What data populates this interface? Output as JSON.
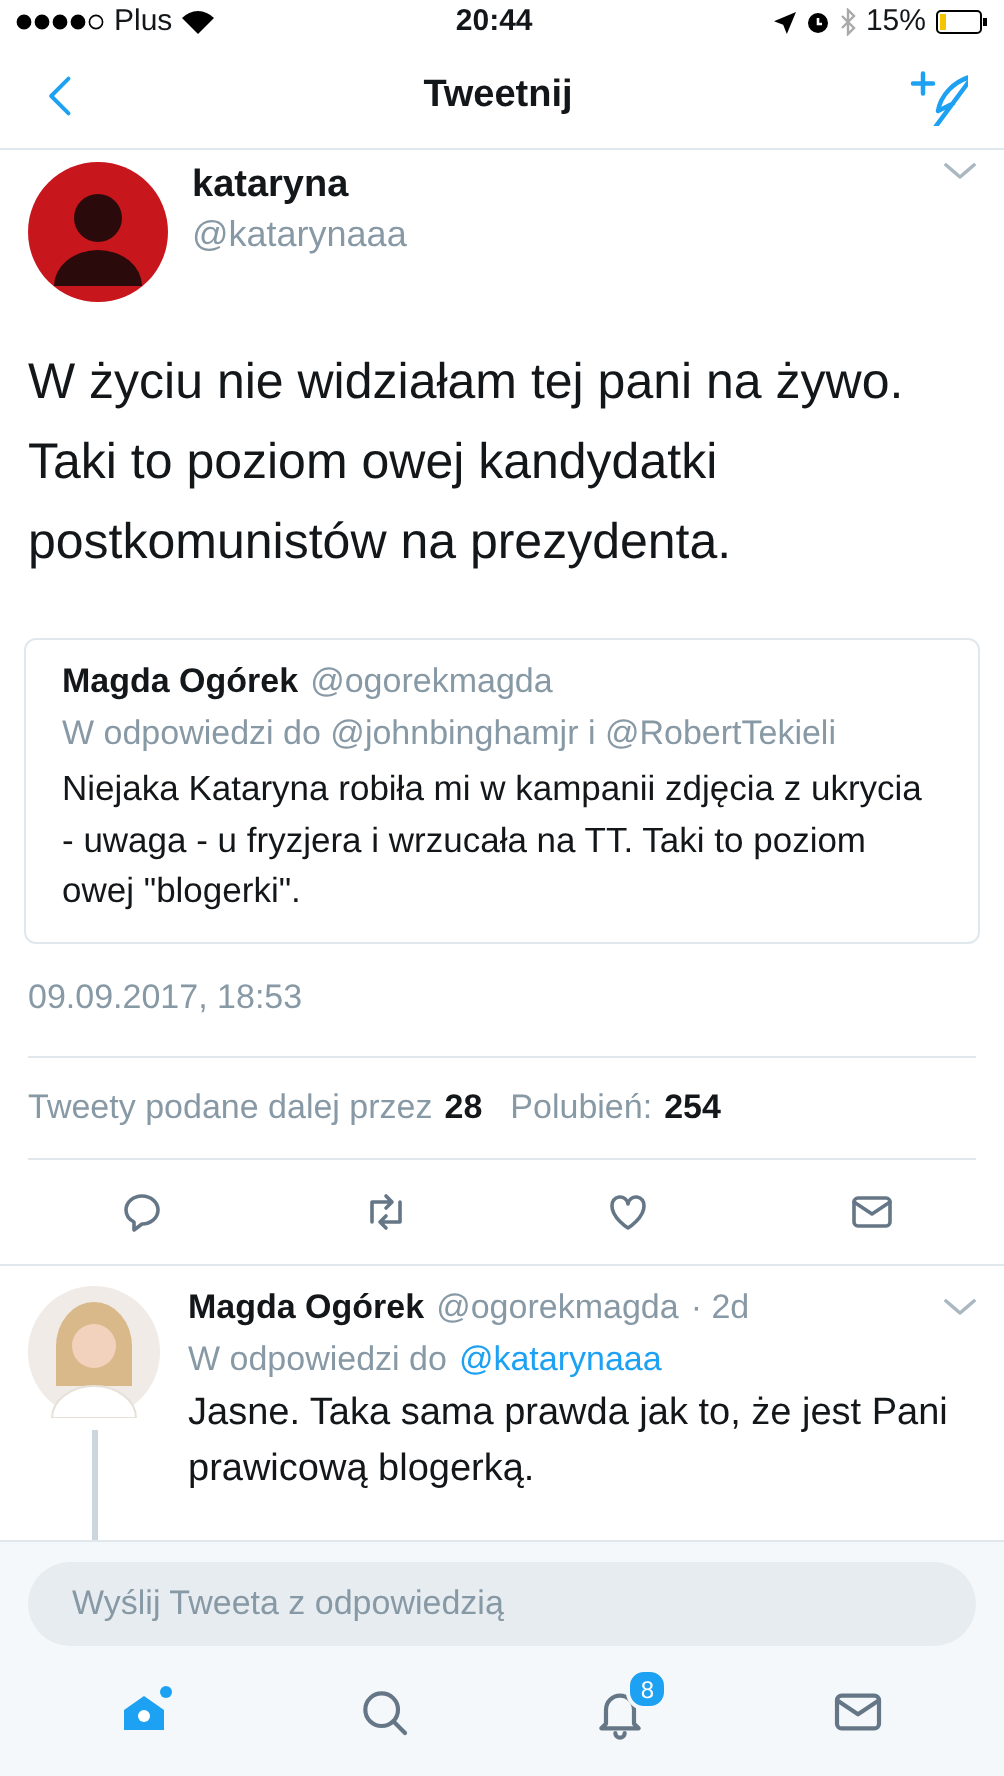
{
  "status_bar": {
    "carrier": "Plus",
    "time": "20:44",
    "battery": "15%"
  },
  "nav": {
    "title": "Tweetnij"
  },
  "tweet": {
    "name": "kataryna",
    "handle": "@katarynaaa",
    "text": "W życiu nie widziałam tej pani na żywo. Taki to poziom owej kandydatki postkomunistów na prezydenta.",
    "quote": {
      "name": "Magda Ogórek",
      "handle": "@ogorekmagda",
      "reply_to": "W odpowiedzi do @johnbinghamjr i @RobertTekieli",
      "text": "Niejaka Kataryna robiła mi w kampanii zdjęcia z ukrycia  - uwaga - u fryzjera i wrzucała na TT. Taki to poziom owej \"blogerki\"."
    },
    "timestamp": "09.09.2017, 18:53",
    "stats": [
      {
        "label": "Tweety podane dalej przez",
        "count": "28"
      },
      {
        "label": "Polubień:",
        "count": "254"
      }
    ],
    "actions": [
      {
        "kind": "reply"
      },
      {
        "kind": "retweet"
      },
      {
        "kind": "like"
      },
      {
        "kind": "message"
      }
    ]
  },
  "reply": {
    "name": "Magda Ogórek",
    "handle": "@ogorekmagda",
    "age": "· 2d",
    "reply_prefix": "W odpowiedzi do",
    "mention": "@katarynaaa",
    "text": "Jasne. Taka sama prawda jak to, że jest Pani prawicową blogerką."
  },
  "compose": {
    "placeholder": "Wyślij Tweeta z odpowiedzią"
  },
  "tab_bar": [
    {
      "kind": "home",
      "selected": true
    },
    {
      "kind": "search",
      "selected": false
    },
    {
      "kind": "notifications",
      "selected": false,
      "badge": "8"
    },
    {
      "kind": "messages",
      "selected": false
    }
  ]
}
